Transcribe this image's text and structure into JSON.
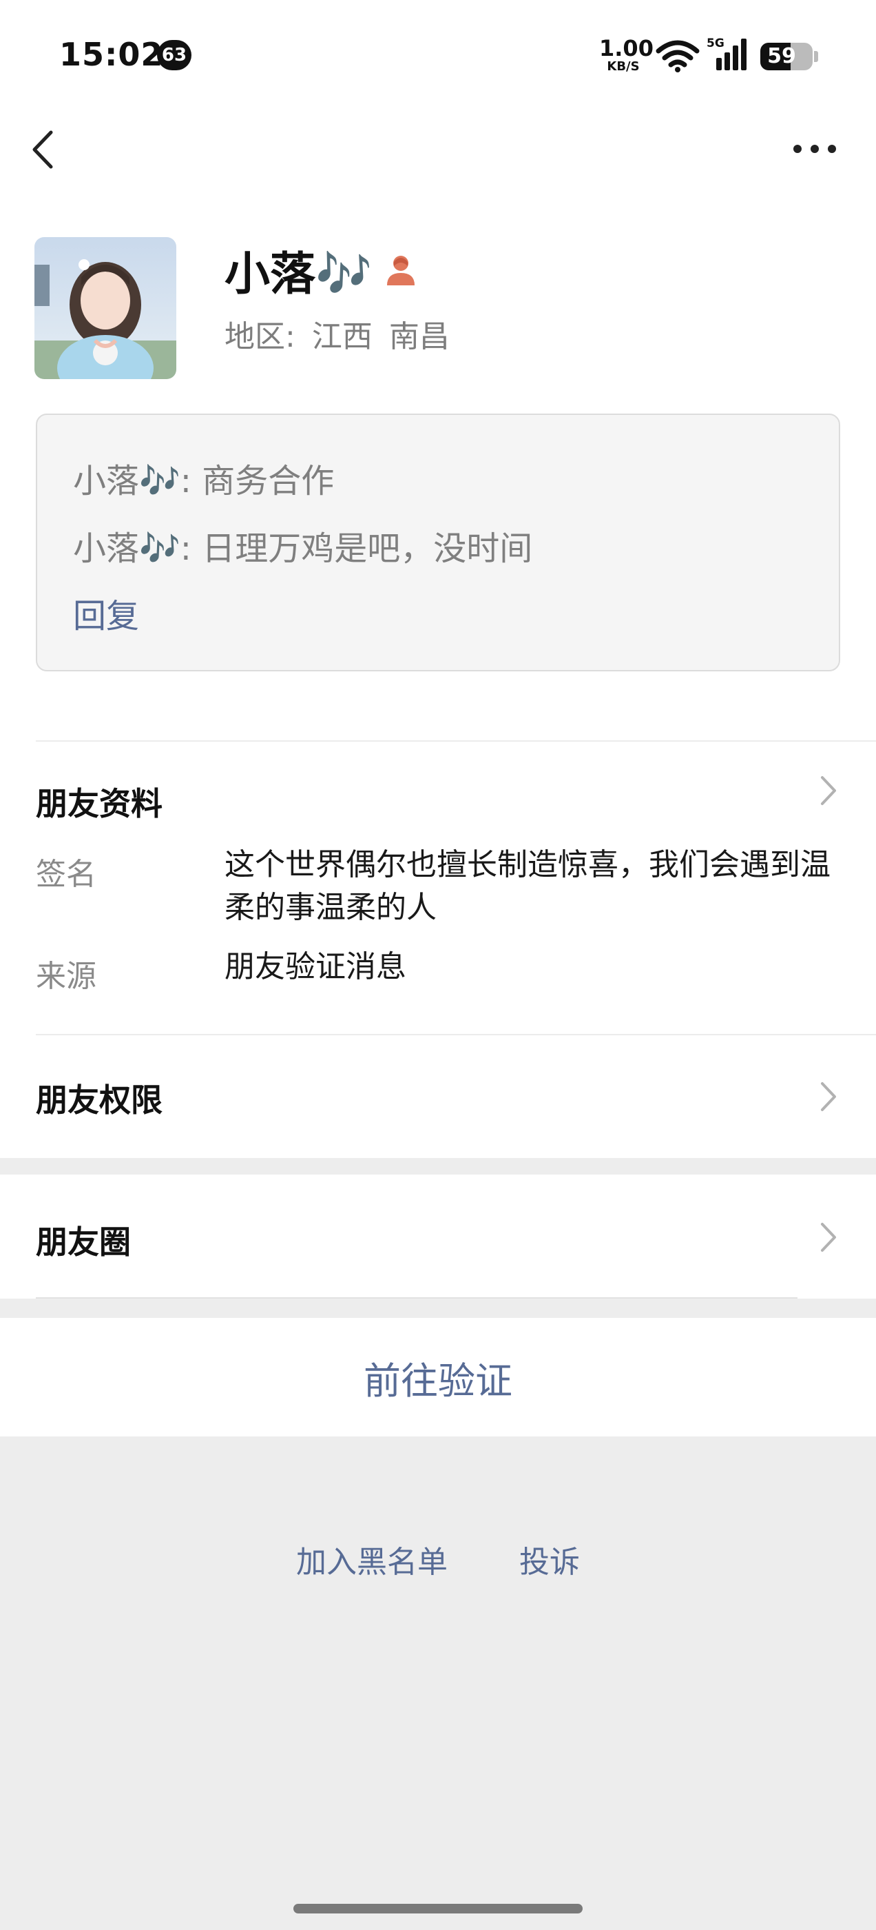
{
  "status_bar": {
    "time": "15:02",
    "notification_count": "63",
    "net_speed_value": "1.00",
    "net_speed_unit": "KB/S",
    "network": "5G",
    "battery": "59"
  },
  "nav": {
    "back_icon": "chevron-left-icon",
    "more_icon": "more-dots-icon"
  },
  "profile": {
    "nickname": "小落🎶",
    "gender_icon": "female-person-icon",
    "gender_color": "#e0775b",
    "region_label": "地区:",
    "region_province": "江西",
    "region_city": "南昌"
  },
  "verification_messages": {
    "line1": "小落🎶: 商务合作",
    "line2": "小落🎶: 日理万鸡是吧，没时间",
    "reply_label": "回复"
  },
  "friend_info": {
    "title": "朋友资料",
    "signature_label": "签名",
    "signature_value": "这个世界偶尔也擅长制造惊喜，我们会遇到温柔的事温柔的人",
    "source_label": "来源",
    "source_value": "朋友验证消息"
  },
  "permissions": {
    "title": "朋友权限"
  },
  "moments": {
    "title": "朋友圈"
  },
  "actions": {
    "verify_label": "前往验证",
    "blacklist_label": "加入黑名单",
    "report_label": "投诉"
  },
  "colors": {
    "link": "#576b95",
    "background": "#ededed"
  }
}
